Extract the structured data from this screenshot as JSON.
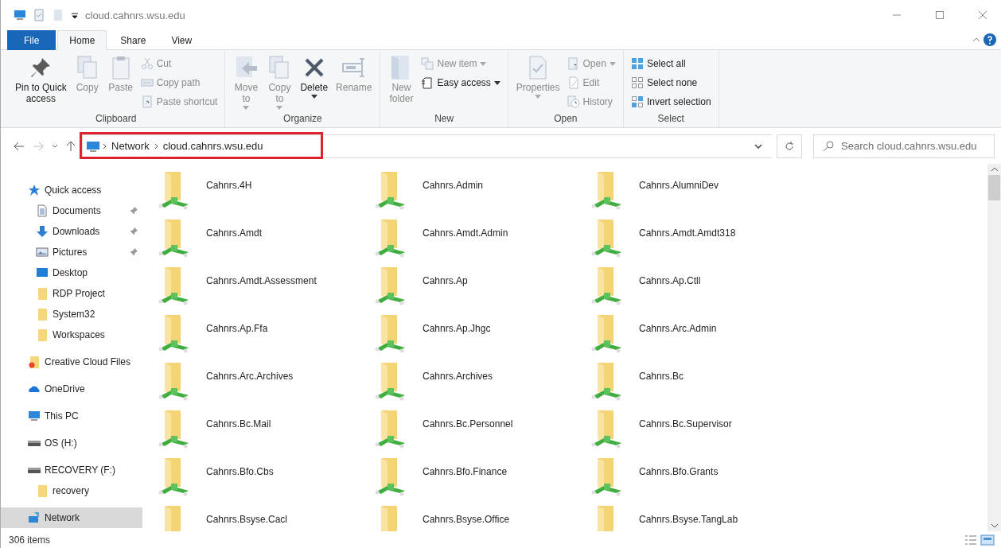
{
  "window": {
    "title": "cloud.cahnrs.wsu.edu"
  },
  "ribbon_tabs": [
    {
      "label": "File",
      "kind": "menu",
      "selected": false
    },
    {
      "label": "Home",
      "kind": "tab",
      "selected": true
    },
    {
      "label": "Share",
      "kind": "tab",
      "selected": false
    },
    {
      "label": "View",
      "kind": "tab",
      "selected": false
    }
  ],
  "ribbon_groups": [
    {
      "label": "Clipboard",
      "large": [
        {
          "label": "Pin to Quick\naccess",
          "kind": "pin",
          "disabled": false,
          "dropdown": false
        },
        {
          "label": "Copy",
          "kind": "copy",
          "disabled": true,
          "dropdown": false
        },
        {
          "label": "Paste",
          "kind": "paste",
          "disabled": true,
          "dropdown": false
        }
      ],
      "small": [
        {
          "label": "Cut",
          "kind": "cut",
          "disabled": true,
          "dropdown": false
        },
        {
          "label": "Copy path",
          "kind": "copy-path",
          "disabled": true,
          "dropdown": false
        },
        {
          "label": "Paste shortcut",
          "kind": "paste-shortcut",
          "disabled": true,
          "dropdown": false
        }
      ]
    },
    {
      "label": "Organize",
      "large": [
        {
          "label": "Move\nto",
          "kind": "move",
          "disabled": true,
          "dropdown": true
        },
        {
          "label": "Copy\nto",
          "kind": "copy-to",
          "disabled": true,
          "dropdown": true
        },
        {
          "label": "Delete",
          "kind": "delete",
          "disabled": false,
          "dropdown": true
        },
        {
          "label": "Rename",
          "kind": "rename",
          "disabled": true,
          "dropdown": false
        }
      ]
    },
    {
      "label": "New",
      "large": [
        {
          "label": "New\nfolder",
          "kind": "new-folder",
          "disabled": true,
          "dropdown": false
        }
      ],
      "small": [
        {
          "label": "New item",
          "kind": "new-item",
          "disabled": true,
          "dropdown": true
        },
        {
          "label": "Easy access",
          "kind": "easy-access",
          "disabled": false,
          "dropdown": true
        }
      ]
    },
    {
      "label": "Open",
      "large": [
        {
          "label": "Properties",
          "kind": "properties",
          "disabled": true,
          "dropdown": true
        }
      ],
      "small": [
        {
          "label": "Open",
          "kind": "open",
          "disabled": true,
          "dropdown": true
        },
        {
          "label": "Edit",
          "kind": "edit",
          "disabled": true,
          "dropdown": false
        },
        {
          "label": "History",
          "kind": "history",
          "disabled": true,
          "dropdown": false
        }
      ]
    },
    {
      "label": "Select",
      "small": [
        {
          "label": "Select all",
          "kind": "select-all",
          "disabled": false,
          "dropdown": false
        },
        {
          "label": "Select none",
          "kind": "select-none",
          "disabled": false,
          "dropdown": false
        },
        {
          "label": "Invert selection",
          "kind": "invert",
          "disabled": false,
          "dropdown": false
        }
      ]
    }
  ],
  "address_bar": {
    "highlighted": true,
    "breadcrumbs": [
      "Network",
      "cloud.cahnrs.wsu.edu"
    ],
    "back_disabled": false,
    "forward_disabled": true
  },
  "search": {
    "placeholder": "Search cloud.cahnrs.wsu.edu"
  },
  "sidebar": {
    "items": [
      {
        "label": "Quick access",
        "kind": "star",
        "selected": false,
        "children": [
          {
            "label": "Documents",
            "kind": "documents",
            "pinned": true,
            "selected": false
          },
          {
            "label": "Downloads",
            "kind": "download",
            "pinned": true,
            "selected": false
          },
          {
            "label": "Pictures",
            "kind": "pictures",
            "pinned": true,
            "selected": false
          },
          {
            "label": "Desktop",
            "kind": "desktop",
            "pinned": false,
            "selected": false
          },
          {
            "label": "RDP Project",
            "kind": "folder",
            "pinned": false,
            "selected": false
          },
          {
            "label": "System32",
            "kind": "folder",
            "pinned": false,
            "selected": false
          },
          {
            "label": "Workspaces",
            "kind": "folder",
            "pinned": false,
            "selected": false
          }
        ]
      },
      {
        "label": "Creative Cloud Files",
        "kind": "cloud-files",
        "selected": false
      },
      {
        "label": "OneDrive",
        "kind": "onedrive",
        "selected": false
      },
      {
        "label": "This PC",
        "kind": "pc",
        "selected": false
      },
      {
        "label": "OS (H:)",
        "kind": "drive",
        "selected": false
      },
      {
        "label": "RECOVERY (F:)",
        "kind": "drive",
        "selected": false,
        "children": [
          {
            "label": "recovery",
            "kind": "folder",
            "pinned": false,
            "selected": false
          }
        ]
      },
      {
        "label": "Network",
        "kind": "network",
        "selected": true
      }
    ]
  },
  "items": [
    "Cahnrs.4H",
    "Cahnrs.Admin",
    "Cahnrs.AlumniDev",
    "Cahnrs.Amdt",
    "Cahnrs.Amdt.Admin",
    "Cahnrs.Amdt.Amdt318",
    "Cahnrs.Amdt.Assessment",
    "Cahnrs.Ap",
    "Cahnrs.Ap.Ctll",
    "Cahnrs.Ap.Ffa",
    "Cahnrs.Ap.Jhgc",
    "Cahnrs.Arc.Admin",
    "Cahnrs.Arc.Archives",
    "Cahnrs.Archives",
    "Cahnrs.Bc",
    "Cahnrs.Bc.Mail",
    "Cahnrs.Bc.Personnel",
    "Cahnrs.Bc.Supervisor",
    "Cahnrs.Bfo.Cbs",
    "Cahnrs.Bfo.Finance",
    "Cahnrs.Bfo.Grants",
    "Cahnrs.Bsyse.Cacl",
    "Cahnrs.Bsyse.Office",
    "Cahnrs.Bsyse.TangLab"
  ],
  "status_bar": {
    "count": "306 items"
  }
}
